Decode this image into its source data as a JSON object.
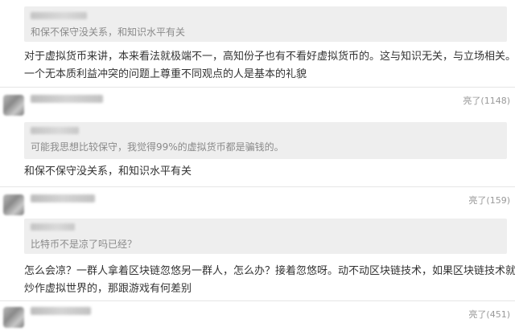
{
  "comments": [
    {
      "quote": "和保不保守没关系，和知识水平有关",
      "body_lines": [
        "对于虚拟货币来讲，本来看法就极端不一，高知份子也有不看好虚拟货币的。这与知识无关，与立场相关。在",
        "一个无本质利益冲突的问题上尊重不同观点的人是基本的礼貌"
      ]
    },
    {
      "like": "亮了(1148)",
      "quote": "可能我思想比较保守，我觉得99%的虚拟货币都是骗钱的。",
      "body_lines": [
        "和保不保守没关系，和知识水平有关"
      ]
    },
    {
      "like": "亮了(159)",
      "quote": "比特币不是凉了吗已经？",
      "body_lines": [
        "怎么会凉？一群人拿着区块链忽悠另一群人，怎么办？接着忽悠呀。动不动区块链技术，如果区块链技术就是",
        "炒作虚拟世界的，那跟游戏有何差别"
      ]
    },
    {
      "like": "亮了(451)"
    }
  ]
}
